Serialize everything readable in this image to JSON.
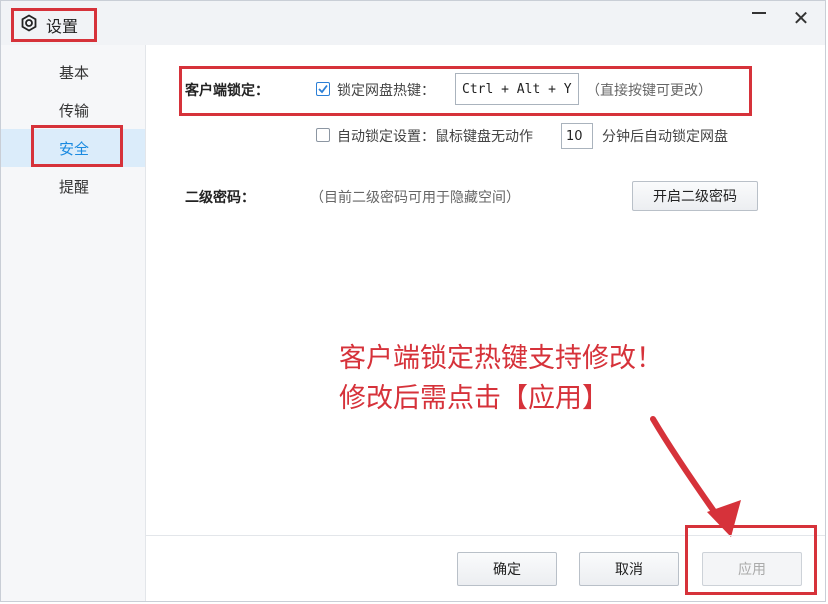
{
  "window": {
    "title": "设置",
    "minimize_label": "—",
    "close_label": "✕"
  },
  "sidebar": {
    "items": [
      {
        "label": "基本"
      },
      {
        "label": "传输"
      },
      {
        "label": "安全"
      },
      {
        "label": "提醒"
      }
    ],
    "active_item": "安全"
  },
  "security": {
    "client_lock_label": "客户端锁定：",
    "lock_hotkey_label": "锁定网盘热键：",
    "lock_hotkey_checked": true,
    "hotkey_value": "Ctrl + Alt + Y",
    "hotkey_hint": "（直接按键可更改）",
    "auto_lock_checked": false,
    "auto_lock_label": "自动锁定设置：鼠标键盘无动作",
    "auto_lock_minutes": "10",
    "auto_lock_suffix": "分钟后自动锁定网盘",
    "second_password_label": "二级密码：",
    "second_password_hint": "（目前二级密码可用于隐藏空间）",
    "enable_second_password_button": "开启二级密码"
  },
  "annotation": {
    "line1": "客户端锁定热键支持修改！",
    "line2": "修改后需点击【应用】"
  },
  "footer": {
    "ok_label": "确定",
    "cancel_label": "取消",
    "apply_label": "应用",
    "apply_disabled": true
  },
  "colors": {
    "highlight_red": "#d6323a",
    "accent_blue": "#1a8ae0",
    "active_bg": "#dbecfa"
  }
}
